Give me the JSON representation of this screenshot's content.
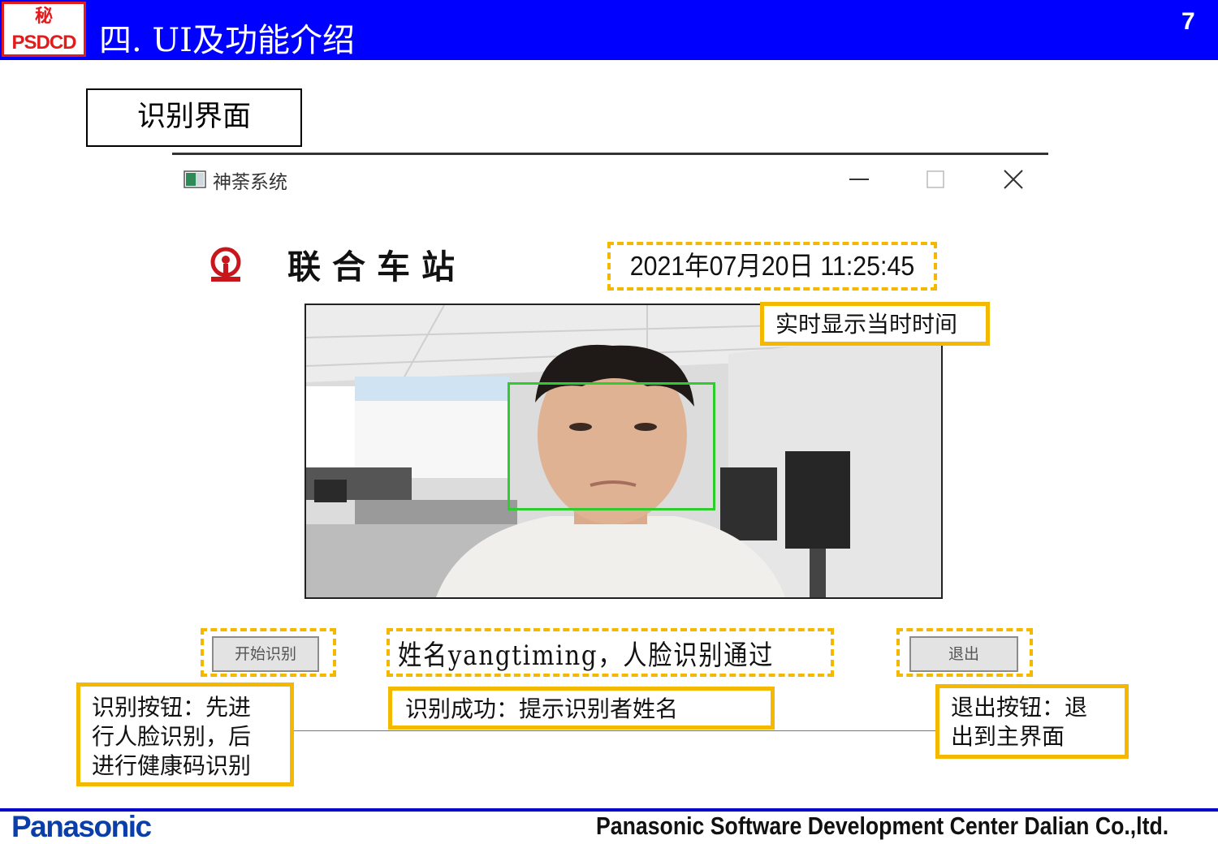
{
  "header": {
    "secret_mark": "秘",
    "dept_code": "PSDCD",
    "title": "四. UI及功能介绍",
    "page_number": "7"
  },
  "section_label": "识别界面",
  "window": {
    "title": "神荼系统",
    "controls": [
      "minimize-icon",
      "maximize-icon",
      "close-icon"
    ]
  },
  "app": {
    "station_name": "联合车站",
    "clock": "2021年07月20日 11:25:45",
    "start_button": "开始识别",
    "result_text": "姓名yangtiming，人脸识别通过",
    "exit_button": "退出"
  },
  "annotations": {
    "clock": "实时显示当时时间",
    "start": [
      "识别按钮：先进",
      "行人脸识别，后",
      "进行健康码识别"
    ],
    "result": "识别成功：提示识别者姓名",
    "exit": [
      "退出按钮：退",
      "出到主界面"
    ]
  },
  "footer": {
    "brand": "Panasonic",
    "company": "Panasonic Software Development Center Dalian Co.,ltd."
  },
  "colors": {
    "header_blue": "#0000ff",
    "highlight_yellow": "#f5b800",
    "face_box_green": "#2ecc2e",
    "secret_red": "#e21b1b",
    "logo_red": "#c8161d"
  }
}
